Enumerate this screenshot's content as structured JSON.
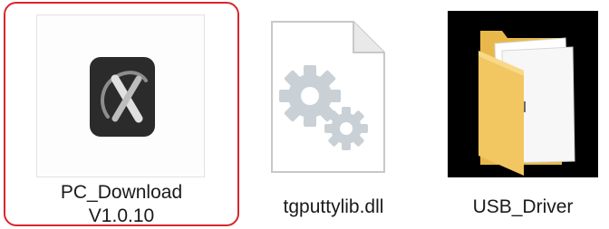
{
  "files": [
    {
      "name": "PC_Download\nV1.0.10",
      "icon": "app-logo-icon",
      "selected": true
    },
    {
      "name": "tgputtylib.dll",
      "icon": "dll-gear-file-icon",
      "selected": false
    },
    {
      "name": "USB_Driver",
      "icon": "folder-icon",
      "selected": false
    }
  ],
  "colors": {
    "selection_border": "#d9262c",
    "app_logo_bg": "#2b2b2b",
    "folder": "#f2c660"
  }
}
